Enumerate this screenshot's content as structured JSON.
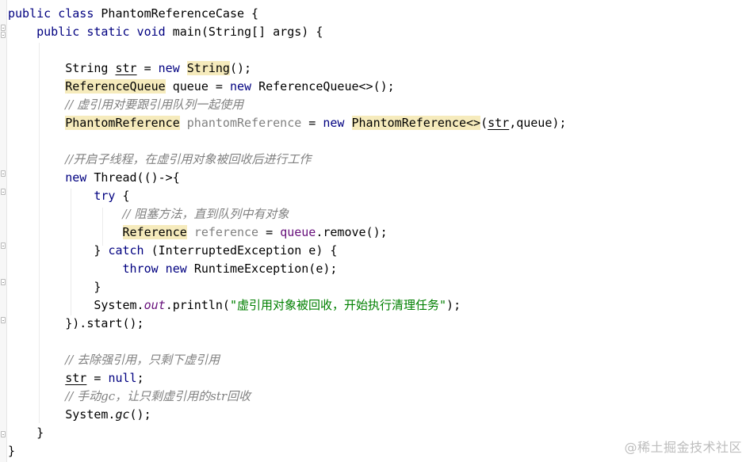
{
  "editor": {
    "lines": [
      {
        "tokens": [
          {
            "t": "public class ",
            "c": "kw"
          },
          {
            "t": "PhantomReferenceCase {",
            "c": ""
          }
        ]
      },
      {
        "tokens": [
          {
            "t": "    "
          },
          {
            "t": "public static void ",
            "c": "kw"
          },
          {
            "t": "main(String[] args) {",
            "c": ""
          }
        ]
      },
      {
        "tokens": [
          {
            "t": ""
          }
        ]
      },
      {
        "tokens": [
          {
            "t": "        String "
          },
          {
            "t": "str",
            "c": "ul"
          },
          {
            "t": " = "
          },
          {
            "t": "new ",
            "c": "kw"
          },
          {
            "t": "String",
            "c": "hl"
          },
          {
            "t": "();"
          }
        ]
      },
      {
        "tokens": [
          {
            "t": "        "
          },
          {
            "t": "ReferenceQueue",
            "c": "hl"
          },
          {
            "t": " queue = "
          },
          {
            "t": "new ",
            "c": "kw"
          },
          {
            "t": "ReferenceQueue<>();"
          }
        ]
      },
      {
        "tokens": [
          {
            "t": "        "
          },
          {
            "t": "// 虚引用对要跟引用队列一起使用",
            "c": "cm"
          }
        ]
      },
      {
        "tokens": [
          {
            "t": "        "
          },
          {
            "t": "PhantomReference",
            "c": "hl"
          },
          {
            "t": " "
          },
          {
            "t": "phantomReference",
            "c": "var-unused"
          },
          {
            "t": " = "
          },
          {
            "t": "new ",
            "c": "kw"
          },
          {
            "t": "PhantomReference<>",
            "c": "hl"
          },
          {
            "t": "("
          },
          {
            "t": "str",
            "c": "ul"
          },
          {
            "t": ",queue);"
          }
        ]
      },
      {
        "tokens": [
          {
            "t": ""
          }
        ]
      },
      {
        "tokens": [
          {
            "t": "        "
          },
          {
            "t": "//开启子线程，在虚引用对象被回收后进行工作",
            "c": "cm"
          }
        ]
      },
      {
        "tokens": [
          {
            "t": "        "
          },
          {
            "t": "new ",
            "c": "kw"
          },
          {
            "t": "Thread(()->{"
          }
        ]
      },
      {
        "tokens": [
          {
            "t": "            "
          },
          {
            "t": "try ",
            "c": "kw"
          },
          {
            "t": "{"
          }
        ]
      },
      {
        "tokens": [
          {
            "t": "                "
          },
          {
            "t": "// 阻塞方法，直到队列中有对象",
            "c": "cm"
          }
        ]
      },
      {
        "tokens": [
          {
            "t": "                "
          },
          {
            "t": "Reference",
            "c": "hl"
          },
          {
            "t": " "
          },
          {
            "t": "reference",
            "c": "var-unused"
          },
          {
            "t": " = "
          },
          {
            "t": "queue",
            "c": "field-plain"
          },
          {
            "t": ".remove();"
          }
        ]
      },
      {
        "tokens": [
          {
            "t": "            } "
          },
          {
            "t": "catch ",
            "c": "kw"
          },
          {
            "t": "(InterruptedException e) {"
          }
        ]
      },
      {
        "tokens": [
          {
            "t": "                "
          },
          {
            "t": "throw new ",
            "c": "kw"
          },
          {
            "t": "RuntimeException(e);"
          }
        ]
      },
      {
        "tokens": [
          {
            "t": "            }"
          }
        ]
      },
      {
        "tokens": [
          {
            "t": "            System."
          },
          {
            "t": "out",
            "c": "field"
          },
          {
            "t": ".println("
          },
          {
            "t": "\"虚引用对象被回收，开始执行清理任务\"",
            "c": "str"
          },
          {
            "t": ");"
          }
        ]
      },
      {
        "tokens": [
          {
            "t": "        }).start();"
          }
        ]
      },
      {
        "tokens": [
          {
            "t": ""
          }
        ]
      },
      {
        "tokens": [
          {
            "t": "        "
          },
          {
            "t": "// 去除强引用，只剩下虚引用",
            "c": "cm"
          }
        ]
      },
      {
        "tokens": [
          {
            "t": "        "
          },
          {
            "t": "str",
            "c": "ul"
          },
          {
            "t": " = "
          },
          {
            "t": "null",
            "c": "kw"
          },
          {
            "t": ";"
          }
        ]
      },
      {
        "tokens": [
          {
            "t": "        "
          },
          {
            "t": "// 手动gc，让只剩虚引用的str回收",
            "c": "cm"
          }
        ]
      },
      {
        "tokens": [
          {
            "t": "        System."
          },
          {
            "t": "gc",
            "c": "italic-m"
          },
          {
            "t": "();"
          }
        ]
      },
      {
        "tokens": [
          {
            "t": "    }"
          }
        ]
      },
      {
        "tokens": [
          {
            "t": "}"
          }
        ]
      }
    ]
  },
  "watermark": "@稀土掘金技术社区",
  "colors": {
    "keyword": "#000080",
    "string": "#008000",
    "comment": "#808080",
    "field": "#660e7a",
    "highlight": "#f6ebbc"
  }
}
